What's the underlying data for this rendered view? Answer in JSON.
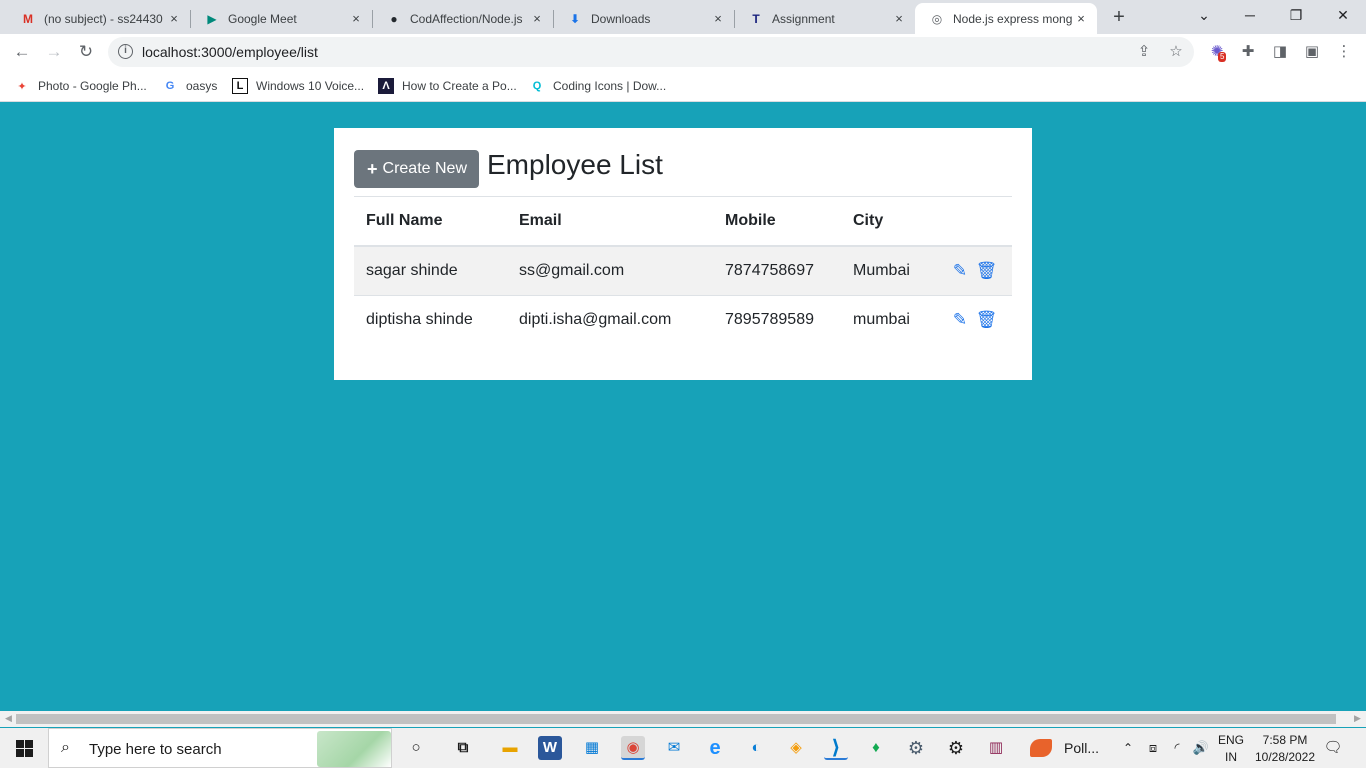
{
  "browser": {
    "tabs": [
      {
        "label": "(no subject) - ss24430",
        "favicon": "gmail-icon",
        "fav_glyph": "M",
        "fav_color": "#d93025",
        "active": false
      },
      {
        "label": "Google Meet",
        "favicon": "meet-icon",
        "fav_glyph": "▶",
        "fav_color": "#00897b",
        "active": false
      },
      {
        "label": "CodAffection/Node.js",
        "favicon": "github-icon",
        "fav_glyph": "●",
        "fav_color": "#24292e",
        "active": false
      },
      {
        "label": "Downloads",
        "favicon": "download-icon",
        "fav_glyph": "⬇",
        "fav_color": "#1a73e8",
        "active": false
      },
      {
        "label": "Assignment",
        "favicon": "t-icon",
        "fav_glyph": "T",
        "fav_color": "#1a237e",
        "active": false
      },
      {
        "label": "Node.js express mong",
        "favicon": "globe-icon",
        "fav_glyph": "◎",
        "fav_color": "#5f6368",
        "active": true
      }
    ],
    "tab_close_glyph": "×",
    "new_tab_glyph": "+",
    "url": "localhost:3000/employee/list",
    "extension_badge": "5",
    "bookmarks": [
      {
        "label": "Photo - Google Ph...",
        "fav_glyph": "✦",
        "fav_color": "#ea4335"
      },
      {
        "label": "oasys",
        "fav_glyph": "G",
        "fav_color": "#4285f4"
      },
      {
        "label": "Windows 10 Voice...",
        "fav_glyph": "L",
        "fav_color": "#111111"
      },
      {
        "label": "How to Create a Po...",
        "fav_glyph": "Λ",
        "fav_color": "#1b1b3a"
      },
      {
        "label": "Coding Icons | Dow...",
        "fav_glyph": "Q",
        "fav_color": "#00bcd4"
      }
    ]
  },
  "page": {
    "create_button_label": "Create New",
    "create_button_glyph": "+",
    "title": "Employee List",
    "columns": [
      "Full Name",
      "Email",
      "Mobile",
      "City"
    ],
    "rows": [
      {
        "full_name": "sagar shinde",
        "email": "ss@gmail.com",
        "mobile": "7874758697",
        "city": "Mumbai"
      },
      {
        "full_name": "diptisha shinde",
        "email": "dipti.isha@gmail.com",
        "mobile": "7895789589",
        "city": "mumbai"
      }
    ],
    "edit_glyph": "✎",
    "delete_glyph": "🗑",
    "colors": {
      "background": "#17a2b8",
      "button": "#6c757d",
      "action": "#1e74e9"
    }
  },
  "taskbar": {
    "search_placeholder": "Type here to search",
    "apps": [
      {
        "name": "cortana-icon",
        "glyph": "○",
        "color": "#1c1c1c"
      },
      {
        "name": "task-view-icon",
        "glyph": "⧉",
        "color": "#1c1c1c"
      },
      {
        "name": "file-explorer-icon",
        "glyph": "▬",
        "color": "#e8a300"
      },
      {
        "name": "word-icon",
        "glyph": "W",
        "color": "#2b579a"
      },
      {
        "name": "store-icon",
        "glyph": "▦",
        "color": "#0078d4"
      },
      {
        "name": "chrome-icon",
        "glyph": "◉",
        "color": "#db4437"
      },
      {
        "name": "mail-icon",
        "glyph": "✉",
        "color": "#0078d4"
      },
      {
        "name": "ie-icon",
        "glyph": "e",
        "color": "#1e90ff"
      },
      {
        "name": "edge-icon",
        "glyph": "◐",
        "color": "#0a7ed6"
      },
      {
        "name": "brave-icon",
        "glyph": "◈",
        "color": "#f49d0c"
      },
      {
        "name": "vscode-icon",
        "glyph": "⟩",
        "color": "#007acc"
      },
      {
        "name": "mongodb-icon",
        "glyph": "♦",
        "color": "#13aa52"
      },
      {
        "name": "control-panel-icon",
        "glyph": "⚙",
        "color": "#4a5b6c"
      },
      {
        "name": "settings-icon",
        "glyph": "⚙",
        "color": "#1c1c1c"
      },
      {
        "name": "winrar-icon",
        "glyph": "▥",
        "color": "#8b2252"
      }
    ],
    "pinned_label": "Poll...",
    "language_top": "ENG",
    "language_bottom": "IN",
    "time": "7:58 PM",
    "date": "10/28/2022"
  }
}
